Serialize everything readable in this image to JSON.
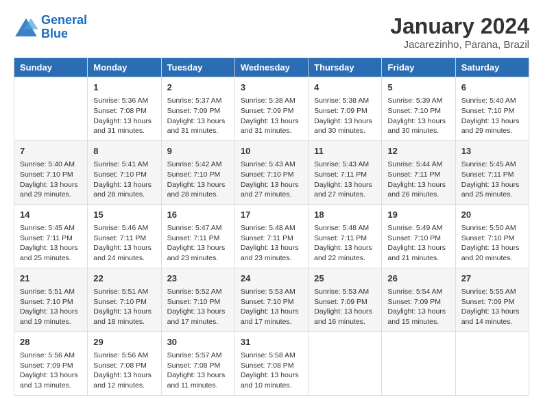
{
  "logo": {
    "line1": "General",
    "line2": "Blue"
  },
  "title": "January 2024",
  "subtitle": "Jacarezinho, Parana, Brazil",
  "days": [
    "Sunday",
    "Monday",
    "Tuesday",
    "Wednesday",
    "Thursday",
    "Friday",
    "Saturday"
  ],
  "weeks": [
    [
      {
        "date": "",
        "info": ""
      },
      {
        "date": "1",
        "info": "Sunrise: 5:36 AM\nSunset: 7:08 PM\nDaylight: 13 hours\nand 31 minutes."
      },
      {
        "date": "2",
        "info": "Sunrise: 5:37 AM\nSunset: 7:09 PM\nDaylight: 13 hours\nand 31 minutes."
      },
      {
        "date": "3",
        "info": "Sunrise: 5:38 AM\nSunset: 7:09 PM\nDaylight: 13 hours\nand 31 minutes."
      },
      {
        "date": "4",
        "info": "Sunrise: 5:38 AM\nSunset: 7:09 PM\nDaylight: 13 hours\nand 30 minutes."
      },
      {
        "date": "5",
        "info": "Sunrise: 5:39 AM\nSunset: 7:10 PM\nDaylight: 13 hours\nand 30 minutes."
      },
      {
        "date": "6",
        "info": "Sunrise: 5:40 AM\nSunset: 7:10 PM\nDaylight: 13 hours\nand 29 minutes."
      }
    ],
    [
      {
        "date": "7",
        "info": "Sunrise: 5:40 AM\nSunset: 7:10 PM\nDaylight: 13 hours\nand 29 minutes."
      },
      {
        "date": "8",
        "info": "Sunrise: 5:41 AM\nSunset: 7:10 PM\nDaylight: 13 hours\nand 28 minutes."
      },
      {
        "date": "9",
        "info": "Sunrise: 5:42 AM\nSunset: 7:10 PM\nDaylight: 13 hours\nand 28 minutes."
      },
      {
        "date": "10",
        "info": "Sunrise: 5:43 AM\nSunset: 7:10 PM\nDaylight: 13 hours\nand 27 minutes."
      },
      {
        "date": "11",
        "info": "Sunrise: 5:43 AM\nSunset: 7:11 PM\nDaylight: 13 hours\nand 27 minutes."
      },
      {
        "date": "12",
        "info": "Sunrise: 5:44 AM\nSunset: 7:11 PM\nDaylight: 13 hours\nand 26 minutes."
      },
      {
        "date": "13",
        "info": "Sunrise: 5:45 AM\nSunset: 7:11 PM\nDaylight: 13 hours\nand 25 minutes."
      }
    ],
    [
      {
        "date": "14",
        "info": "Sunrise: 5:45 AM\nSunset: 7:11 PM\nDaylight: 13 hours\nand 25 minutes."
      },
      {
        "date": "15",
        "info": "Sunrise: 5:46 AM\nSunset: 7:11 PM\nDaylight: 13 hours\nand 24 minutes."
      },
      {
        "date": "16",
        "info": "Sunrise: 5:47 AM\nSunset: 7:11 PM\nDaylight: 13 hours\nand 23 minutes."
      },
      {
        "date": "17",
        "info": "Sunrise: 5:48 AM\nSunset: 7:11 PM\nDaylight: 13 hours\nand 23 minutes."
      },
      {
        "date": "18",
        "info": "Sunrise: 5:48 AM\nSunset: 7:11 PM\nDaylight: 13 hours\nand 22 minutes."
      },
      {
        "date": "19",
        "info": "Sunrise: 5:49 AM\nSunset: 7:10 PM\nDaylight: 13 hours\nand 21 minutes."
      },
      {
        "date": "20",
        "info": "Sunrise: 5:50 AM\nSunset: 7:10 PM\nDaylight: 13 hours\nand 20 minutes."
      }
    ],
    [
      {
        "date": "21",
        "info": "Sunrise: 5:51 AM\nSunset: 7:10 PM\nDaylight: 13 hours\nand 19 minutes."
      },
      {
        "date": "22",
        "info": "Sunrise: 5:51 AM\nSunset: 7:10 PM\nDaylight: 13 hours\nand 18 minutes."
      },
      {
        "date": "23",
        "info": "Sunrise: 5:52 AM\nSunset: 7:10 PM\nDaylight: 13 hours\nand 17 minutes."
      },
      {
        "date": "24",
        "info": "Sunrise: 5:53 AM\nSunset: 7:10 PM\nDaylight: 13 hours\nand 17 minutes."
      },
      {
        "date": "25",
        "info": "Sunrise: 5:53 AM\nSunset: 7:09 PM\nDaylight: 13 hours\nand 16 minutes."
      },
      {
        "date": "26",
        "info": "Sunrise: 5:54 AM\nSunset: 7:09 PM\nDaylight: 13 hours\nand 15 minutes."
      },
      {
        "date": "27",
        "info": "Sunrise: 5:55 AM\nSunset: 7:09 PM\nDaylight: 13 hours\nand 14 minutes."
      }
    ],
    [
      {
        "date": "28",
        "info": "Sunrise: 5:56 AM\nSunset: 7:09 PM\nDaylight: 13 hours\nand 13 minutes."
      },
      {
        "date": "29",
        "info": "Sunrise: 5:56 AM\nSunset: 7:08 PM\nDaylight: 13 hours\nand 12 minutes."
      },
      {
        "date": "30",
        "info": "Sunrise: 5:57 AM\nSunset: 7:08 PM\nDaylight: 13 hours\nand 11 minutes."
      },
      {
        "date": "31",
        "info": "Sunrise: 5:58 AM\nSunset: 7:08 PM\nDaylight: 13 hours\nand 10 minutes."
      },
      {
        "date": "",
        "info": ""
      },
      {
        "date": "",
        "info": ""
      },
      {
        "date": "",
        "info": ""
      }
    ]
  ]
}
